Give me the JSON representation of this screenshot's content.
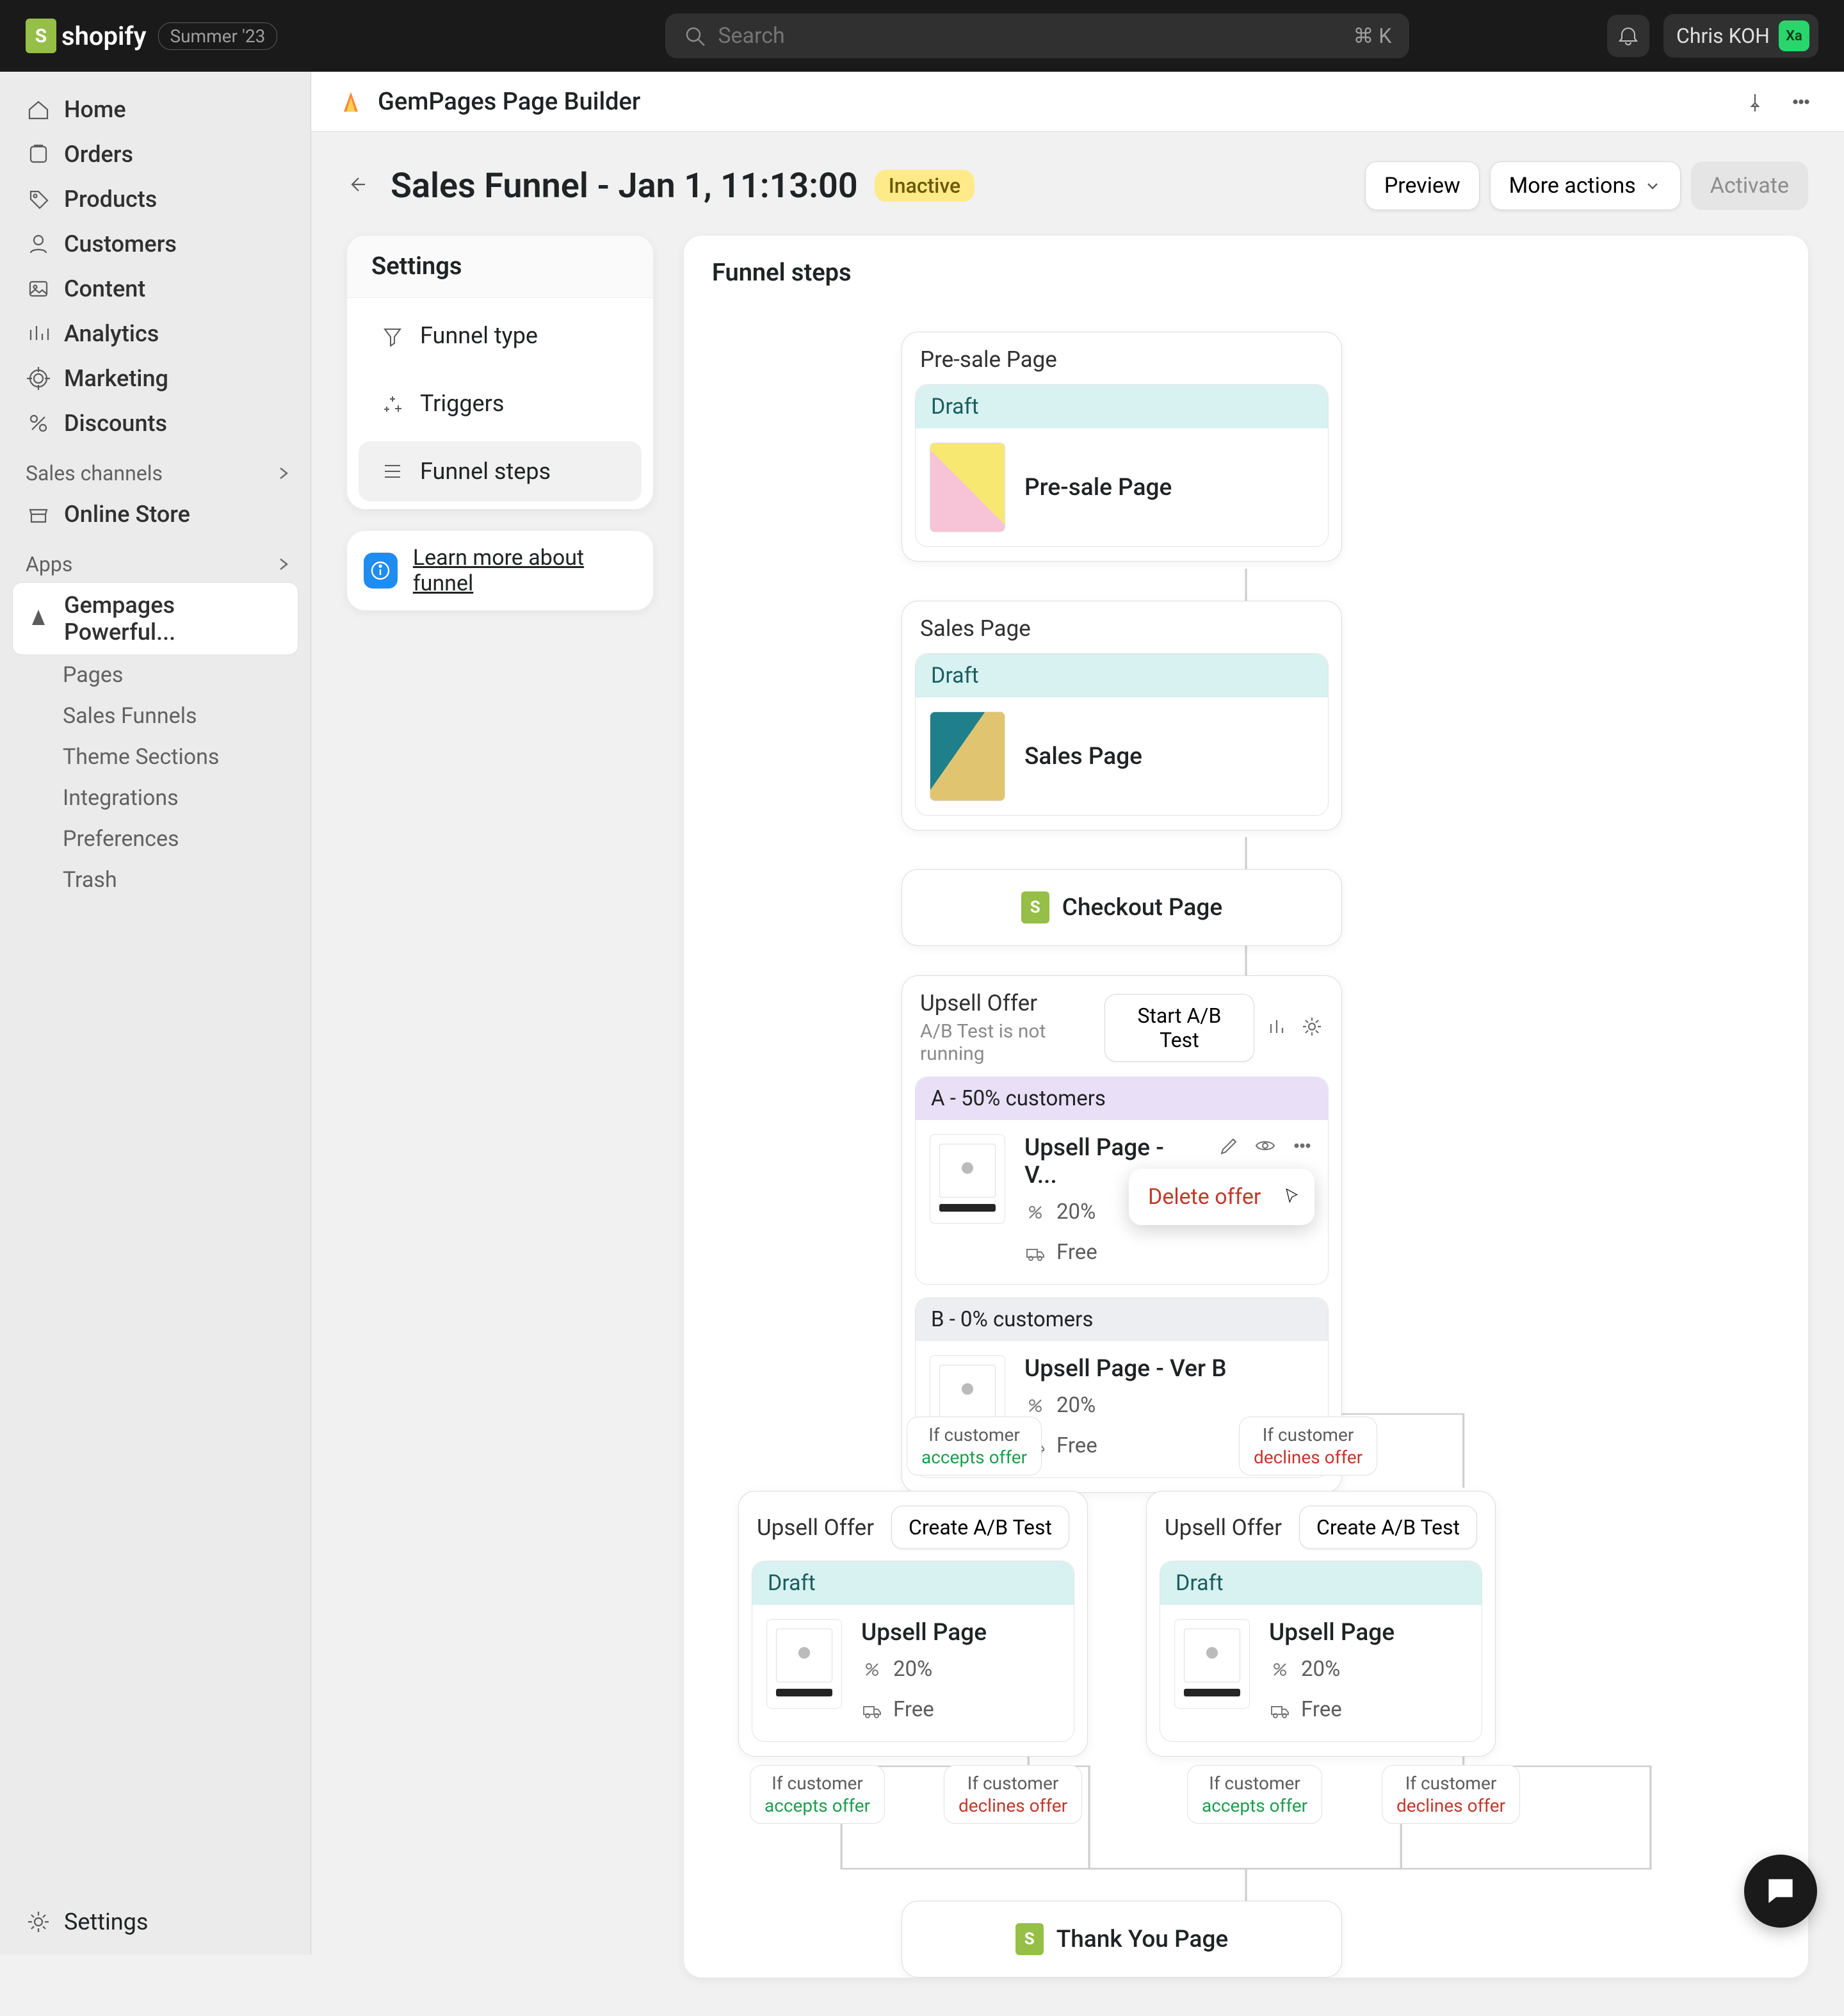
{
  "topbar": {
    "brand": "shopify",
    "badge": "Summer '23",
    "search_placeholder": "Search",
    "kbd": "⌘ K",
    "user_name": "Chris KOH",
    "avatar_initials": "Xa"
  },
  "sidebar": {
    "items": [
      {
        "label": "Home"
      },
      {
        "label": "Orders"
      },
      {
        "label": "Products"
      },
      {
        "label": "Customers"
      },
      {
        "label": "Content"
      },
      {
        "label": "Analytics"
      },
      {
        "label": "Marketing"
      },
      {
        "label": "Discounts"
      }
    ],
    "sales_channels_header": "Sales channels",
    "online_store": "Online Store",
    "apps_header": "Apps",
    "gempages": "Gempages Powerful...",
    "subitems": [
      {
        "label": "Pages"
      },
      {
        "label": "Sales Funnels"
      },
      {
        "label": "Theme Sections"
      },
      {
        "label": "Integrations"
      },
      {
        "label": "Preferences"
      },
      {
        "label": "Trash"
      }
    ],
    "settings": "Settings"
  },
  "app_header": {
    "title": "GemPages Page Builder"
  },
  "page": {
    "title": "Sales Funnel - Jan 1, 11:13:00",
    "status": "Inactive",
    "preview_btn": "Preview",
    "more_actions_btn": "More actions",
    "activate_btn": "Activate"
  },
  "settings_card": {
    "title": "Settings",
    "items": [
      {
        "label": "Funnel type"
      },
      {
        "label": "Triggers"
      },
      {
        "label": "Funnel steps"
      }
    ],
    "learn_more": "Learn more about funnel"
  },
  "funnel": {
    "title": "Funnel steps",
    "presale": {
      "header": "Pre-sale Page",
      "draft": "Draft",
      "page": "Pre-sale Page"
    },
    "sales": {
      "header": "Sales Page",
      "draft": "Draft",
      "page": "Sales Page"
    },
    "checkout": "Checkout Page",
    "thank_you": "Thank You Page",
    "upsell_main": {
      "header": "Upsell Offer",
      "ab_status": "A/B Test is not running",
      "start_ab": "Start A/B Test",
      "variant_a_label": "A - 50% customers",
      "variant_a_page": "Upsell Page - V...",
      "variant_a_discount": "20%",
      "variant_a_ship": "Free",
      "variant_b_label": "B - 0% customers",
      "variant_b_page": "Upsell Page - Ver B",
      "variant_b_discount": "20%",
      "variant_b_ship": "Free",
      "delete_offer": "Delete offer"
    },
    "cond": {
      "text": "If customer",
      "accept": "accepts offer",
      "decline": "declines offer"
    },
    "upsell_child": {
      "header": "Upsell Offer",
      "create_ab": "Create A/B Test",
      "draft": "Draft",
      "page": "Upsell Page",
      "discount": "20%",
      "ship": "Free"
    }
  }
}
